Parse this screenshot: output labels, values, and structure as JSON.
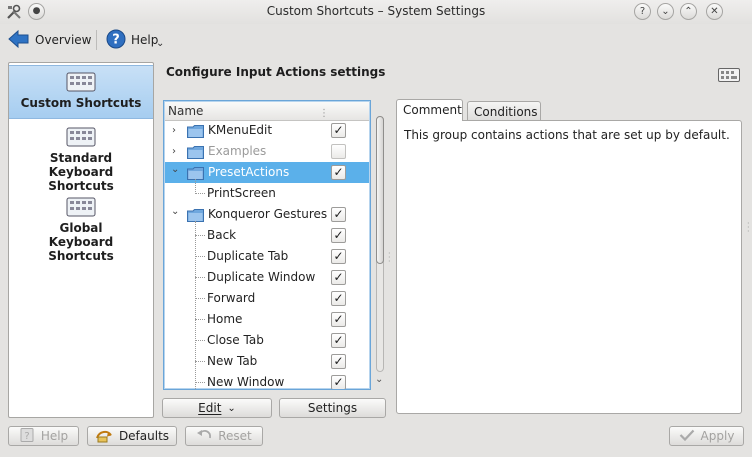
{
  "window": {
    "title": "Custom Shortcuts – System Settings"
  },
  "toolbar": {
    "overview_label": "Overview",
    "help_label": "Help"
  },
  "sidebar": {
    "items": [
      {
        "label": "Custom Shortcuts",
        "selected": true
      },
      {
        "label": "Standard Keyboard Shortcuts",
        "selected": false
      },
      {
        "label": "Global Keyboard Shortcuts",
        "selected": false
      }
    ]
  },
  "main": {
    "heading": "Configure Input Actions settings",
    "tree": {
      "column_header": "Name",
      "rows": [
        {
          "label": "KMenuEdit",
          "checked": true,
          "folder": true,
          "expanded": false,
          "depth": 0,
          "dimmed": false,
          "selected": false
        },
        {
          "label": "Examples",
          "checked": false,
          "folder": true,
          "expanded": false,
          "depth": 0,
          "dimmed": true,
          "selected": false
        },
        {
          "label": "PresetActions",
          "checked": true,
          "folder": true,
          "expanded": true,
          "depth": 0,
          "dimmed": false,
          "selected": true
        },
        {
          "label": "PrintScreen",
          "checked": false,
          "folder": false,
          "expanded": false,
          "depth": 1,
          "dimmed": false,
          "selected": false,
          "show_check": false
        },
        {
          "label": "Konqueror Gestures",
          "checked": true,
          "folder": true,
          "expanded": true,
          "depth": 0,
          "dimmed": false,
          "selected": false
        },
        {
          "label": "Back",
          "checked": true,
          "folder": false,
          "depth": 1
        },
        {
          "label": "Duplicate Tab",
          "checked": true,
          "folder": false,
          "depth": 1
        },
        {
          "label": "Duplicate Window",
          "checked": true,
          "folder": false,
          "depth": 1
        },
        {
          "label": "Forward",
          "checked": true,
          "folder": false,
          "depth": 1
        },
        {
          "label": "Home",
          "checked": true,
          "folder": false,
          "depth": 1
        },
        {
          "label": "Close Tab",
          "checked": true,
          "folder": false,
          "depth": 1
        },
        {
          "label": "New Tab",
          "checked": true,
          "folder": false,
          "depth": 1
        },
        {
          "label": "New Window",
          "checked": true,
          "folder": false,
          "depth": 1
        }
      ]
    },
    "edit_button": "Edit",
    "settings_button": "Settings",
    "tabs": [
      {
        "label": "Comment",
        "active": true
      },
      {
        "label": "Conditions",
        "active": false
      }
    ],
    "comment_text": "This group contains actions that are set up by default."
  },
  "footer": {
    "help_label": "Help",
    "defaults_label": "Defaults",
    "reset_label": "Reset",
    "apply_label": "Apply"
  },
  "colors": {
    "selection": "#5bb0ea",
    "sidebar_selection": "#a6cdf0",
    "window_bg": "#e4e3e1"
  }
}
